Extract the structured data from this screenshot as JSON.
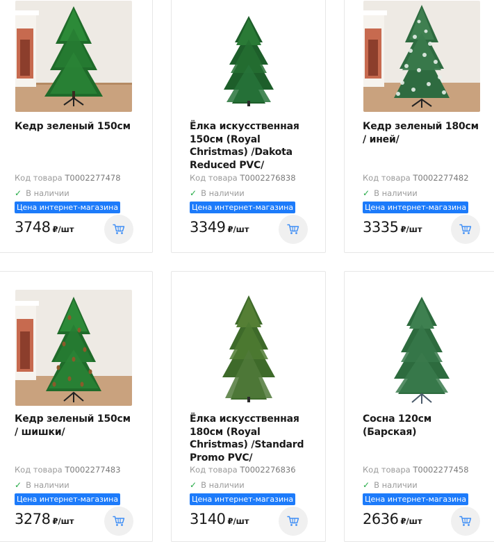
{
  "colors": {
    "accent": "#1d7bfa",
    "in_stock_check": "#22aa44",
    "cart_button_bg": "#f0f0f0"
  },
  "products": [
    {
      "title": "Кедр зеленый 150см",
      "code_label": "Код товара",
      "code": "T0002277478",
      "stock": "В наличии",
      "badge": "Цена интернет-магазина",
      "price": "3748",
      "unit": "₽/шт",
      "image_icon": "christmas-tree-photo-interior"
    },
    {
      "title": "Ёлка искусственная 150см (Royal Christmas) /Dakota Reduced PVC/",
      "code_label": "Код товара",
      "code": "T0002276838",
      "stock": "В наличии",
      "badge": "Цена интернет-магазина",
      "price": "3349",
      "unit": "₽/шт",
      "image_icon": "christmas-tree-photo-white"
    },
    {
      "title": "Кедр зеленый 180см / иней/",
      "code_label": "Код товара",
      "code": "T0002277482",
      "stock": "В наличии",
      "badge": "Цена интернет-магазина",
      "price": "3335",
      "unit": "₽/шт",
      "image_icon": "frosted-christmas-tree-photo-interior"
    },
    {
      "title": "Кедр зеленый 150см / шишки/",
      "code_label": "Код товара",
      "code": "T0002277483",
      "stock": "В наличии",
      "badge": "Цена интернет-магазина",
      "price": "3278",
      "unit": "₽/шт",
      "image_icon": "christmas-tree-with-cones-photo-interior"
    },
    {
      "title": "Ёлка искусственная 180см (Royal Christmas) /Standard Promo PVC/",
      "code_label": "Код товара",
      "code": "T0002276836",
      "stock": "В наличии",
      "badge": "Цена интернет-магазина",
      "price": "3140",
      "unit": "₽/шт",
      "image_icon": "christmas-tree-photo-white"
    },
    {
      "title": "Сосна 120см (Барская)",
      "code_label": "Код товара",
      "code": "T0002277458",
      "stock": "В наличии",
      "badge": "Цена интернет-магазина",
      "price": "2636",
      "unit": "₽/шт",
      "image_icon": "pine-tree-photo-white"
    }
  ]
}
